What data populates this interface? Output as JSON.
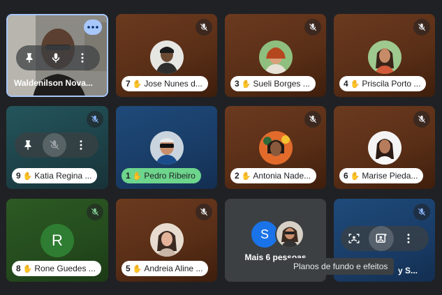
{
  "participants": {
    "self": {
      "name": "Waldenilson Nova..."
    },
    "jose": {
      "number": "7",
      "name": "Jose Nunes d..."
    },
    "sueli": {
      "number": "3",
      "name": "Sueli Borges ..."
    },
    "priscila": {
      "number": "4",
      "name": "Priscila Porto ..."
    },
    "katia": {
      "number": "9",
      "name": "Katia Regina ..."
    },
    "pedro": {
      "number": "1",
      "name": "Pedro Ribeiro"
    },
    "antonia": {
      "number": "2",
      "name": "Antonia Nade..."
    },
    "marise": {
      "number": "6",
      "name": "Marise Pieda..."
    },
    "rone": {
      "number": "8",
      "name": "Rone Guedes ...",
      "initial": "R"
    },
    "andreia": {
      "number": "5",
      "name": "Andreia Aline ..."
    },
    "more": {
      "initial": "S",
      "label": "Mais 6 pessoas"
    },
    "last": {
      "name_tail": "y S..."
    }
  },
  "hand_icon": "✋",
  "tooltip": "Planos de fundo e efeitos",
  "colors": {
    "background": "#202124",
    "self_border": "#a8c7fa",
    "active_speaker_pill": "#6dd58c",
    "letter_avatar": "#2e7d32",
    "more_avatar": "#1a73e8"
  }
}
